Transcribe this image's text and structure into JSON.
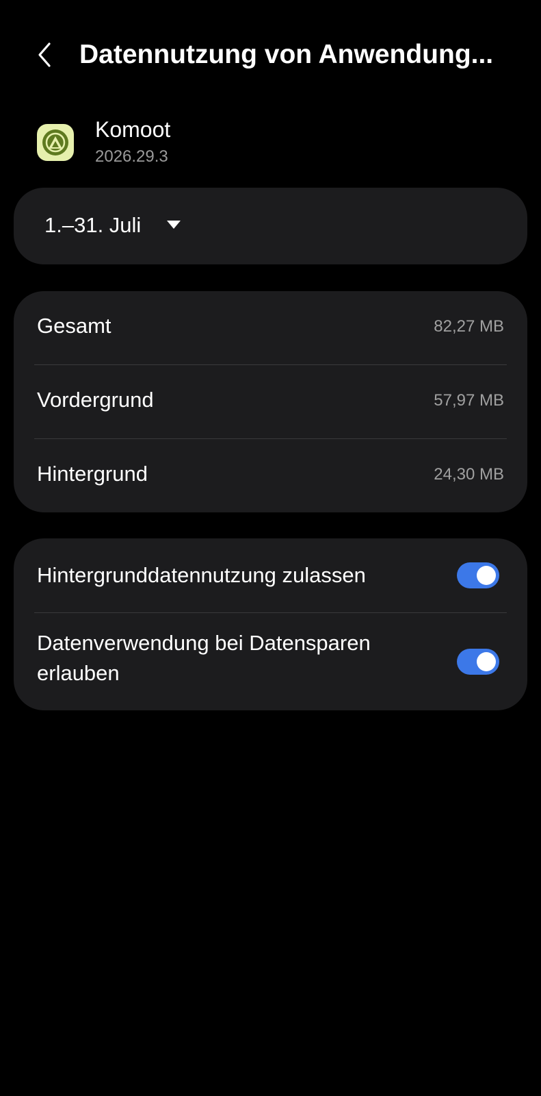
{
  "header": {
    "back_icon": "chevron-left-icon",
    "title": "Datennutzung von Anwendung..."
  },
  "app": {
    "name": "Komoot",
    "version": "2026.29.3",
    "icon": "komoot-icon",
    "icon_bg_color": "#e6f0ad",
    "icon_fg_color": "#5e7a20"
  },
  "period": {
    "label": "1.–31. Juli",
    "dropdown_icon": "triangle-down-icon"
  },
  "usage": {
    "rows": [
      {
        "label": "Gesamt",
        "value": "82,27 MB"
      },
      {
        "label": "Vordergrund",
        "value": "57,97 MB"
      },
      {
        "label": "Hintergrund",
        "value": "24,30 MB"
      }
    ]
  },
  "settings": {
    "background_data": {
      "label": "Hintergrunddatennutzung zulassen",
      "enabled": true
    },
    "data_saver": {
      "label": "Datenverwendung bei Datensparen erlauben",
      "enabled": true
    }
  },
  "colors": {
    "background": "#000000",
    "card": "#1c1c1e",
    "toggle_on": "#3c78e8",
    "secondary_text": "#a0a0a0"
  }
}
